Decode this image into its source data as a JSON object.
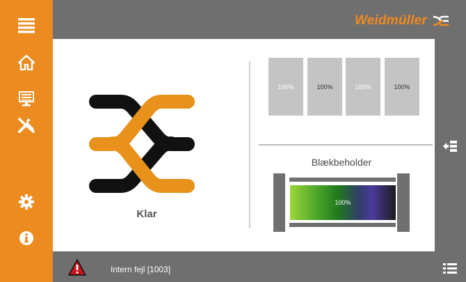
{
  "sidebar": {
    "items": [
      {
        "icon": "menu-icon"
      },
      {
        "icon": "home-icon"
      },
      {
        "icon": "monitor-icon"
      },
      {
        "icon": "tools-icon"
      },
      {
        "icon": "settings-gear-icon"
      },
      {
        "icon": "info-icon"
      }
    ]
  },
  "header": {
    "brand": "Weidmüller"
  },
  "main": {
    "status": "Klar",
    "tanks": [
      {
        "label": "100%",
        "color": "#ffffff"
      },
      {
        "label": "100%",
        "color": "#333333"
      },
      {
        "label": "100%",
        "color": "#ffffff"
      },
      {
        "label": "100%",
        "color": "#333333"
      }
    ],
    "ink_title": "Blækbeholder",
    "ink_level": "100%"
  },
  "footer": {
    "error_text": "Intern fejl [1003]"
  },
  "colors": {
    "accent": "#ec8b1f",
    "logo_orange": "#e8921c",
    "logo_black": "#111111",
    "panel_grey": "#6f6f6f"
  }
}
